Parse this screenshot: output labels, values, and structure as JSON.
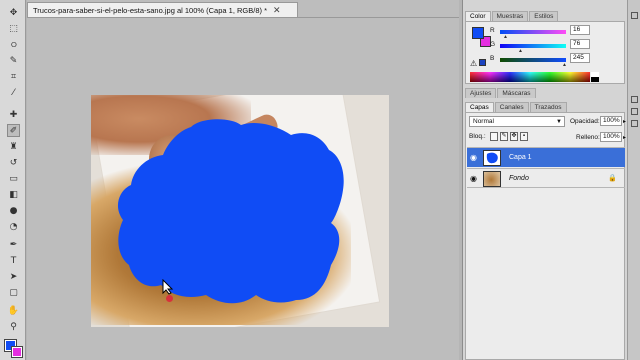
{
  "document": {
    "tab_title": "Trucos-para-saber-si-el-pelo-esta-sano.jpg al 100% (Capa 1, RGB/8) *",
    "close_glyph": "✕"
  },
  "tools": {
    "icons": [
      "move-tool-icon",
      "marquee-tool-icon",
      "lasso-tool-icon",
      "quick-select-tool-icon",
      "crop-tool-icon",
      "eyedropper-tool-icon",
      "healing-brush-tool-icon",
      "brush-tool-icon",
      "clone-stamp-tool-icon",
      "history-brush-tool-icon",
      "eraser-tool-icon",
      "gradient-tool-icon",
      "blur-tool-icon",
      "dodge-tool-icon",
      "pen-tool-icon",
      "type-tool-icon",
      "path-select-tool-icon",
      "shape-tool-icon",
      "hand-tool-icon",
      "zoom-tool-icon"
    ],
    "foreground_color": "#104cf5",
    "background_color": "#e52ee0"
  },
  "color_panel": {
    "tabs": [
      "Color",
      "Muestras",
      "Estilos"
    ],
    "channels": [
      {
        "label": "R",
        "value": "16"
      },
      {
        "label": "G",
        "value": "76"
      },
      {
        "label": "B",
        "value": "245"
      }
    ]
  },
  "adjust_panel": {
    "tabs": [
      "Ajustes",
      "Máscaras"
    ]
  },
  "layers_panel": {
    "tabs": [
      "Capas",
      "Canales",
      "Trazados"
    ],
    "blend_mode": "Normal",
    "opacity_label": "Opacidad:",
    "opacity_value": "100%",
    "lock_label": "Bloq.:",
    "fill_label": "Relleno:",
    "fill_value": "100%",
    "layers": [
      {
        "name": "Capa 1",
        "selected": true
      },
      {
        "name": "Fondo",
        "selected": false
      }
    ]
  },
  "colors": {
    "accent": "#3a6fd8",
    "paint_blue": "#104cf5"
  }
}
